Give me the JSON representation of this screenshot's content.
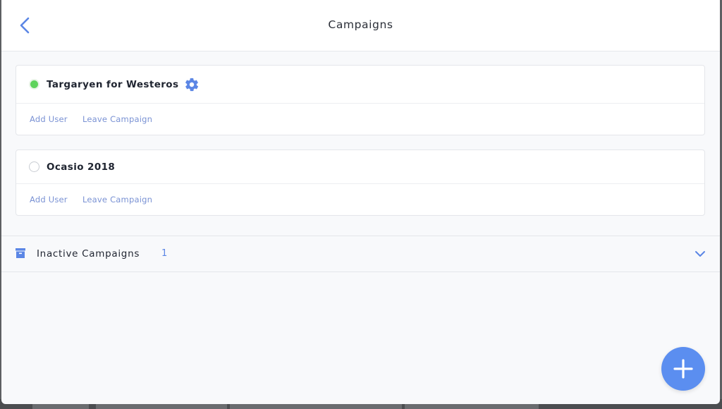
{
  "header": {
    "title": "Campaigns",
    "back_icon": "chevron-left-icon"
  },
  "campaigns": [
    {
      "name": "Targaryen for Westeros",
      "status": "active",
      "status_color": "#5ed35b",
      "has_settings": true,
      "settings_icon": "gear-icon",
      "actions": [
        "Add User",
        "Leave Campaign"
      ]
    },
    {
      "name": "Ocasio 2018",
      "status": "inactive",
      "has_settings": false,
      "actions": [
        "Add User",
        "Leave Campaign"
      ]
    }
  ],
  "inactive_section": {
    "label": "Inactive Campaigns",
    "count": "1",
    "icon": "archive-icon",
    "toggle_icon": "chevron-down-icon"
  },
  "fab": {
    "icon": "plus-icon",
    "color": "#5b8ef0"
  },
  "colors": {
    "accent": "#5b86e5",
    "link": "#7a92d4",
    "active_status": "#5ed35b"
  }
}
